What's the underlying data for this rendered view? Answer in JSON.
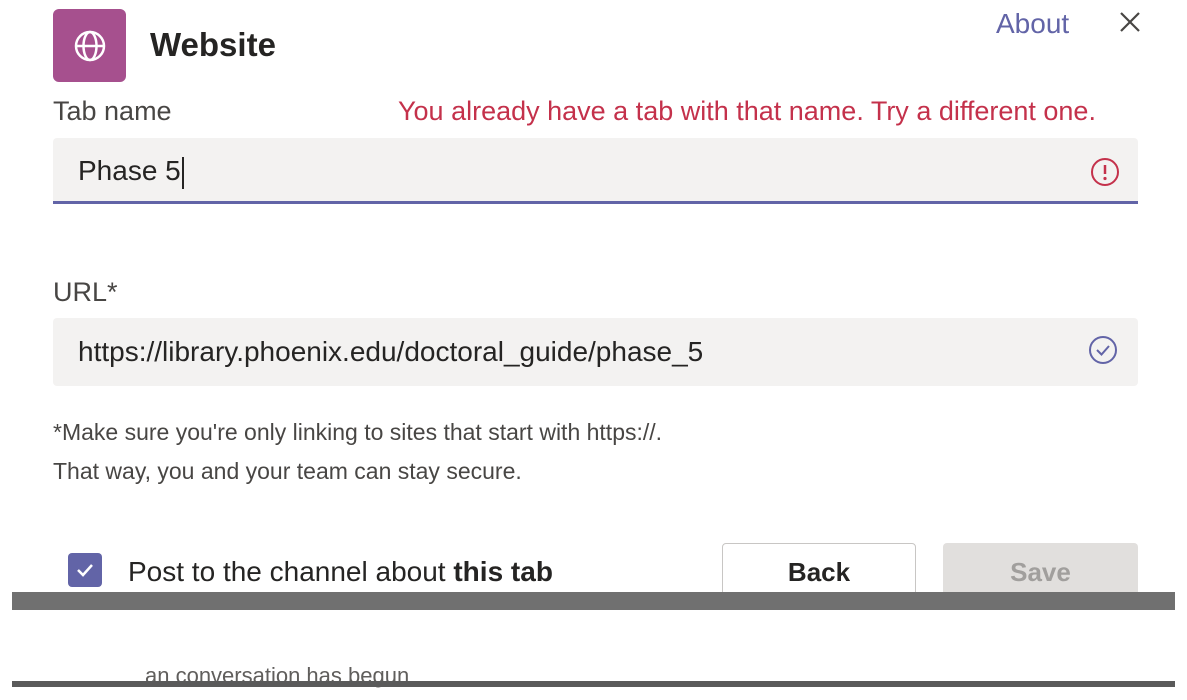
{
  "dialog": {
    "title": "Website",
    "about_label": "About",
    "close_icon": "close-icon",
    "app_icon": "globe-icon",
    "accent_color": "#6264a7",
    "app_icon_color": "#a6508e",
    "error_color": "#c4314b"
  },
  "tab_name": {
    "label": "Tab name",
    "value": "Phase 5",
    "error": "You already have a tab with that name. Try a different one.",
    "status_icon": "error-icon"
  },
  "url": {
    "label": "URL*",
    "value": "https://library.phoenix.edu/doctoral_guide/phase_5",
    "status_icon": "check-circle-icon"
  },
  "note": {
    "line1": "*Make sure you're only linking to sites that start with https://.",
    "line2": "That way, you and your team can stay secure."
  },
  "footer": {
    "post_prefix": "Post to the channel about",
    "post_bold": "this tab",
    "post_checked": true,
    "back_label": "Back",
    "save_label": "Save",
    "partial_text": "an conversation has begun"
  }
}
